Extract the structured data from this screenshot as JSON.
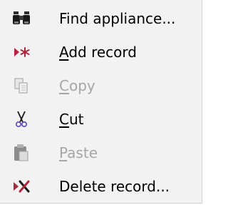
{
  "menu": {
    "items": [
      {
        "id": "find",
        "icon": "binoculars-icon",
        "label_first": "",
        "label_rest": "Find appliance...",
        "disabled": false
      },
      {
        "id": "add",
        "icon": "new-record-icon",
        "label_first": "A",
        "label_rest": "dd record",
        "disabled": false
      },
      {
        "id": "copy",
        "icon": "copy-icon",
        "label_first": "C",
        "label_rest": "opy",
        "disabled": true
      },
      {
        "id": "cut",
        "icon": "scissors-icon",
        "label_first": "C",
        "label_rest": "ut",
        "disabled": false
      },
      {
        "id": "paste",
        "icon": "paste-icon",
        "label_first": "P",
        "label_rest": "aste",
        "disabled": true
      },
      {
        "id": "delete",
        "icon": "delete-record-icon",
        "label_first": "",
        "label_rest": "Delete record...",
        "disabled": false
      }
    ]
  },
  "colors": {
    "menu_background": "#f2f2f2",
    "text": "#000000",
    "disabled_text": "#a6a6a6",
    "accent_red": "#b3243d"
  }
}
